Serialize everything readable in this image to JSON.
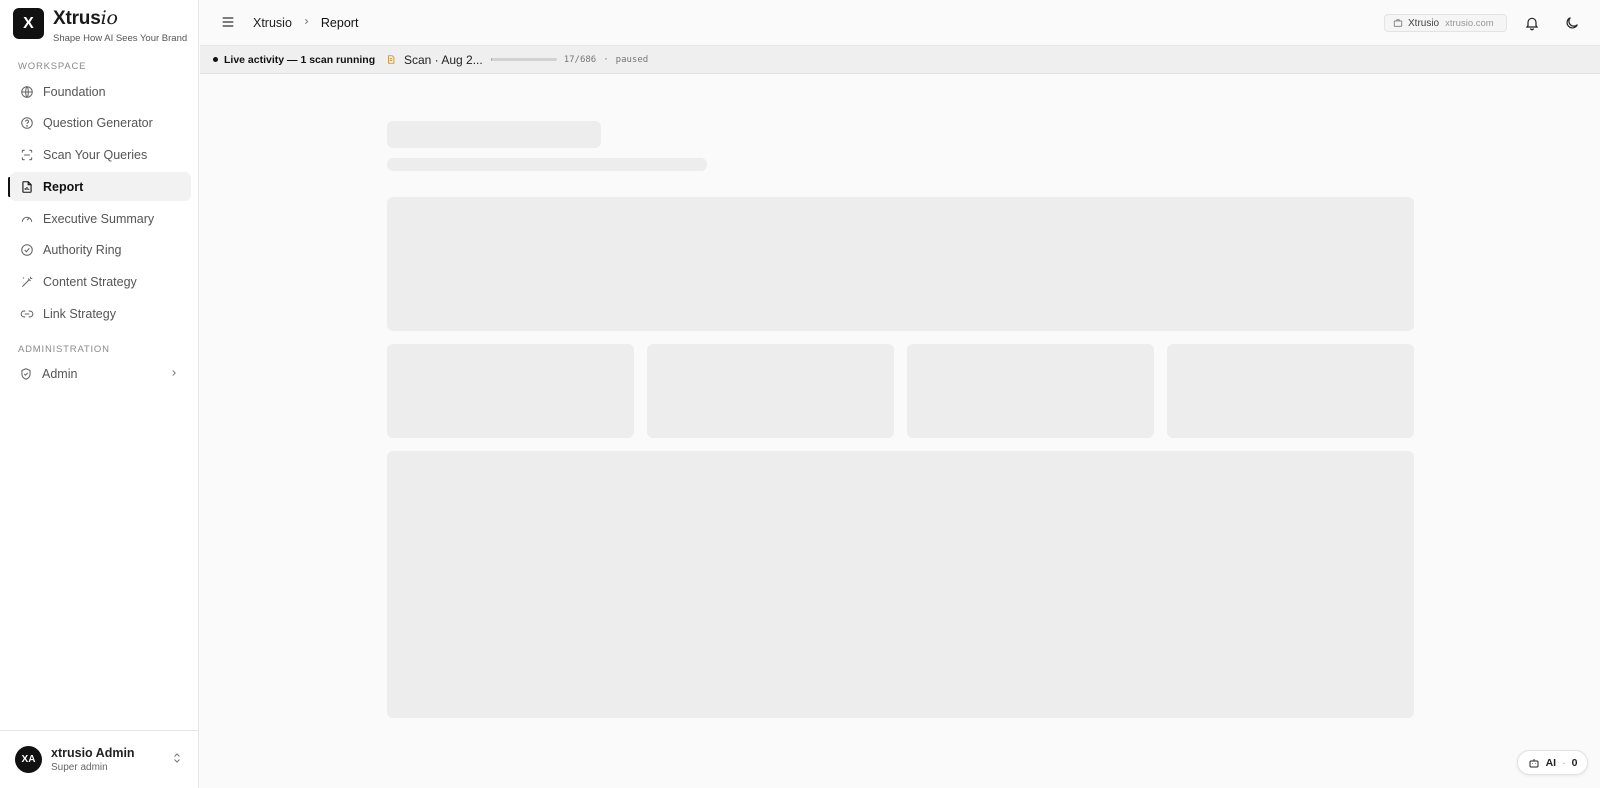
{
  "brand": {
    "logo_letter": "X",
    "name_main": "Xtrus",
    "name_italic": "io",
    "tagline": "Shape How AI Sees Your Brand"
  },
  "sidebar": {
    "workspace_label": "WORKSPACE",
    "items": [
      {
        "label": "Foundation",
        "icon": "globe-icon"
      },
      {
        "label": "Question Generator",
        "icon": "help-circle-icon"
      },
      {
        "label": "Scan Your Queries",
        "icon": "scan-icon"
      },
      {
        "label": "Report",
        "icon": "file-chart-icon",
        "active": true
      },
      {
        "label": "Executive Summary",
        "icon": "gauge-icon"
      },
      {
        "label": "Authority Ring",
        "icon": "check-circle-icon"
      },
      {
        "label": "Content Strategy",
        "icon": "wand-icon"
      },
      {
        "label": "Link Strategy",
        "icon": "link-icon"
      }
    ],
    "admin_label": "ADMINISTRATION",
    "admin_item": {
      "label": "Admin",
      "icon": "shield-icon"
    }
  },
  "user": {
    "initials": "XA",
    "name": "xtrusio Admin",
    "role": "Super admin"
  },
  "header": {
    "breadcrumb": [
      "Xtrusio",
      "Report"
    ],
    "domain_name": "Xtrusio",
    "domain_url": "xtrusio.com"
  },
  "activity": {
    "live_text": "Live activity — 1 scan running",
    "scan_title": "Scan · Aug 2...",
    "count": "17/686",
    "progress": 0.025,
    "status": "paused"
  },
  "ai_badge": {
    "label": "AI",
    "count": "0"
  },
  "colors": {
    "accent": "#111111",
    "skeleton": "#ededed",
    "scan_icon": "#c98b1a"
  }
}
